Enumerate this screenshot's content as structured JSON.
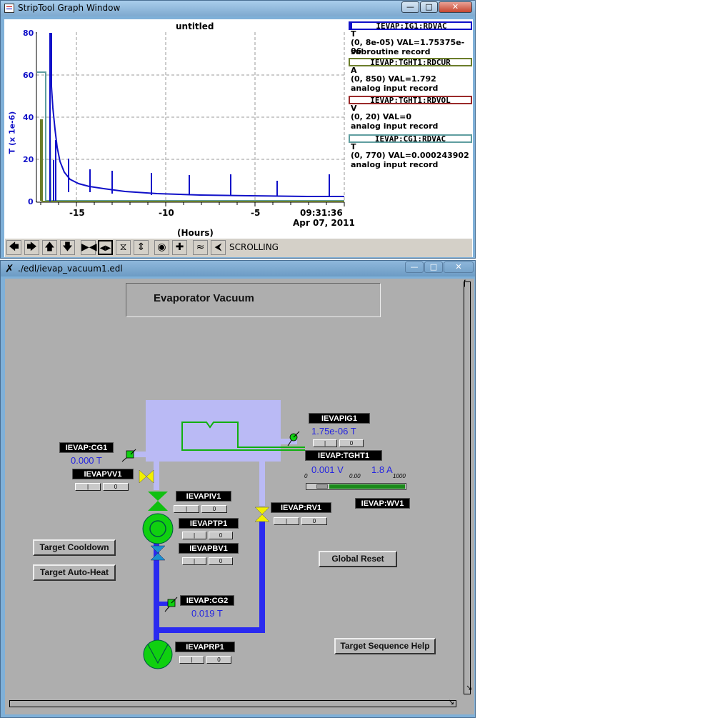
{
  "strip_window": {
    "title": "StripTool Graph Window",
    "plot_title": "untitled",
    "y_axis_label": "T (x 1e-6)",
    "x_axis_label": "(Hours)",
    "y_ticks": [
      "80",
      "60",
      "40",
      "20",
      "0"
    ],
    "x_ticks": [
      "-15",
      "-10",
      "-5"
    ],
    "time_label": "09:31:36",
    "date_label": "Apr 07, 2011",
    "mode_label": "SCROLLING",
    "legend": [
      {
        "name": "IEVAP:IG1:RDVAC",
        "unit": "T",
        "range_val": "(0, 8e-05) VAL=1.75375e-06",
        "record": "subroutine record",
        "color": "#1010c8"
      },
      {
        "name": "IEVAP:TGHT1:RDCUR",
        "unit": "A",
        "range_val": "(0, 850) VAL=1.792",
        "record": "analog input record",
        "color": "#6b7d2a"
      },
      {
        "name": "IEVAP:TGHT1:RDVOL",
        "unit": "V",
        "range_val": "(0, 20) VAL=0",
        "record": "analog input record",
        "color": "#9a2a2a"
      },
      {
        "name": "IEVAP:CG1:RDVAC",
        "unit": "T",
        "range_val": "(0, 770) VAL=0.000243902",
        "record": "analog input record",
        "color": "#5f9ea0"
      }
    ],
    "toolbar_icons": [
      "arrow-left-icon",
      "arrow-right-icon",
      "arrow-up-icon",
      "arrow-down-icon",
      "zoom-in-horizontal-icon",
      "zoom-out-horizontal-icon",
      "zoom-in-vertical-icon",
      "zoom-out-vertical-icon",
      "pause-icon",
      "crosshair-icon",
      "autoscale-icon",
      "refresh-icon"
    ]
  },
  "edm_window": {
    "title": "./edl/ievap_vacuum1.edl",
    "heading": "Evaporator Vacuum",
    "labels": {
      "ig1": "IEVAPIG1",
      "cg1": "IEVAP:CG1",
      "vv1": "IEVAPVV1",
      "tght1": "IEVAP:TGHT1",
      "iv1": "IEVAPIV1",
      "tp1": "IEVAPTP1",
      "bv1": "IEVAPBV1",
      "rv1": "IEVAP:RV1",
      "wv1": "IEVAP:WV1",
      "cg2": "IEVAP:CG2",
      "rp1": "IEVAPRP1"
    },
    "values": {
      "ig1": "1.75e-06 T",
      "cg1": "0.000 T",
      "tght1_v": "0.001 V",
      "tght1_a": "1.8 A",
      "cg2": "0.019 T"
    },
    "scale": {
      "min": "0",
      "mid": "0.00",
      "max": "1000"
    },
    "tght1_bar_fraction": 0.0018,
    "small_button_label": "0",
    "buttons": {
      "cooldown": "Target Cooldown",
      "autoheat": "Target Auto-Heat",
      "reset": "Global Reset",
      "help": "Target Sequence Help"
    }
  }
}
